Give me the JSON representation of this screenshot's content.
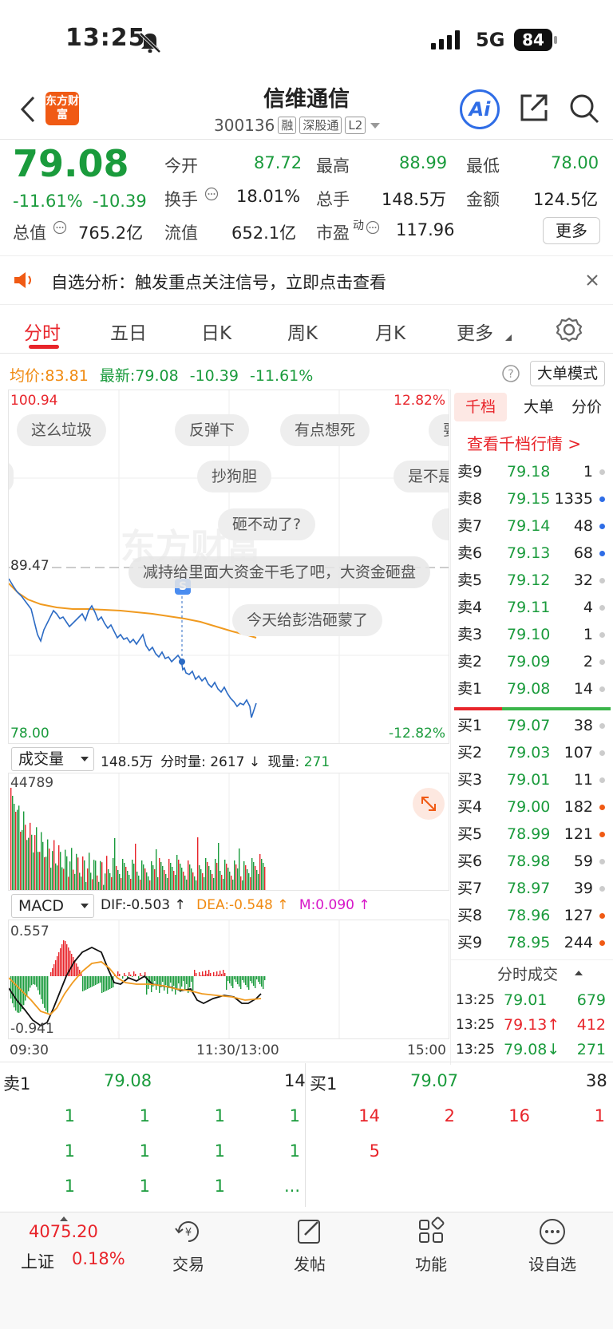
{
  "status": {
    "time": "13:25",
    "network": "5G",
    "battery": "84"
  },
  "header": {
    "title": "信维通信",
    "code": "300136",
    "tags": [
      "融",
      "深股通",
      "L2"
    ],
    "logo_text": "东方财富",
    "ai_label": "Ai"
  },
  "quote": {
    "price": "79.08",
    "change_pct": "-11.61%",
    "change": "-10.39",
    "open_label": "今开",
    "open": "87.72",
    "high_label": "最高",
    "high": "88.99",
    "low_label": "最低",
    "low": "78.00",
    "turnover_label": "换手",
    "turnover": "18.01%",
    "volume_label": "总手",
    "volume": "148.5万",
    "amount_label": "金额",
    "amount": "124.5亿",
    "mcap_label": "总值",
    "mcap": "765.2亿",
    "float_label": "流值",
    "float": "652.1亿",
    "pe_label": "市盈",
    "pe_sup": "动",
    "pe": "117.96",
    "more": "更多"
  },
  "notice": {
    "text": "自选分析：触发重点关注信号，立即点击查看"
  },
  "tabs": [
    "分时",
    "五日",
    "日K",
    "周K",
    "月K",
    "更多"
  ],
  "chart_info": {
    "avg_label": "均价:",
    "avg": "83.81",
    "latest_label": "最新:",
    "latest": "79.08",
    "chg": "-10.39",
    "pct": "-11.61%",
    "mode_btn": "大单模式"
  },
  "chart": {
    "top_price": "100.94",
    "top_pct": "12.82%",
    "ref_price": "89.47",
    "bottom_price": "78.00",
    "bottom_pct": "-12.82%",
    "marker": "S",
    "watermark": "东方财富"
  },
  "bubbles": [
    "这么垃圾",
    "反弹下",
    "有点想死",
    "要",
    "抄狗胆",
    "是不是",
    "砸不动了?",
    "减持给里面大资金干毛了吧，大资金砸盘",
    "今天给彭浩砸蒙了"
  ],
  "volume": {
    "label": "成交量",
    "total": "148.5万",
    "period_label": "分时量:",
    "period": "2617",
    "arrow": "↓",
    "now_label": "现量:",
    "now": "271",
    "max": "44789"
  },
  "macd": {
    "label": "MACD",
    "dif": "DIF:-0.503 ↑",
    "dea": "DEA:-0.548 ↑",
    "m": "M:0.090 ↑",
    "top": "0.557",
    "bottom": "-0.941"
  },
  "time_axis": [
    "09:30",
    "11:30/13:00",
    "15:00"
  ],
  "orderbook": {
    "tabs": [
      "千档",
      "大单",
      "分价"
    ],
    "link": "查看千档行情 >",
    "asks": [
      {
        "k": "卖9",
        "p": "79.18",
        "q": "1"
      },
      {
        "k": "卖8",
        "p": "79.15",
        "q": "1335"
      },
      {
        "k": "卖7",
        "p": "79.14",
        "q": "48"
      },
      {
        "k": "卖6",
        "p": "79.13",
        "q": "68"
      },
      {
        "k": "卖5",
        "p": "79.12",
        "q": "32"
      },
      {
        "k": "卖4",
        "p": "79.11",
        "q": "4"
      },
      {
        "k": "卖3",
        "p": "79.10",
        "q": "1"
      },
      {
        "k": "卖2",
        "p": "79.09",
        "q": "2"
      },
      {
        "k": "卖1",
        "p": "79.08",
        "q": "14"
      }
    ],
    "bids": [
      {
        "k": "买1",
        "p": "79.07",
        "q": "38"
      },
      {
        "k": "买2",
        "p": "79.03",
        "q": "107"
      },
      {
        "k": "买3",
        "p": "79.01",
        "q": "11"
      },
      {
        "k": "买4",
        "p": "79.00",
        "q": "182"
      },
      {
        "k": "买5",
        "p": "78.99",
        "q": "121"
      },
      {
        "k": "买6",
        "p": "78.98",
        "q": "59"
      },
      {
        "k": "买7",
        "p": "78.97",
        "q": "39"
      },
      {
        "k": "买8",
        "p": "78.96",
        "q": "127"
      },
      {
        "k": "买9",
        "p": "78.95",
        "q": "244"
      }
    ],
    "trades_title": "分时成交",
    "trades": [
      {
        "t": "13:25",
        "p": "79.01",
        "q": "679"
      },
      {
        "t": "13:25",
        "p": "79.13↑",
        "q": "412"
      },
      {
        "t": "13:25",
        "p": "79.08↓",
        "q": "271"
      }
    ]
  },
  "queue": {
    "sell_label": "卖1",
    "sell_price": "79.08",
    "sell_qty": "14",
    "buy_label": "买1",
    "buy_price": "79.07",
    "buy_qty": "38",
    "sell_rows": [
      [
        "1",
        "1",
        "1",
        "1"
      ],
      [
        "1",
        "1",
        "1",
        "1"
      ],
      [
        "1",
        "1",
        "1",
        "..."
      ]
    ],
    "buy_rows": [
      [
        "14",
        "2",
        "16",
        "1"
      ],
      [
        "5",
        "",
        "",
        ""
      ]
    ]
  },
  "nav": {
    "index_value": "4075.20",
    "index_name": "上证",
    "index_pct": "0.18%",
    "items": [
      "交易",
      "发帖",
      "功能",
      "设自选"
    ]
  }
}
